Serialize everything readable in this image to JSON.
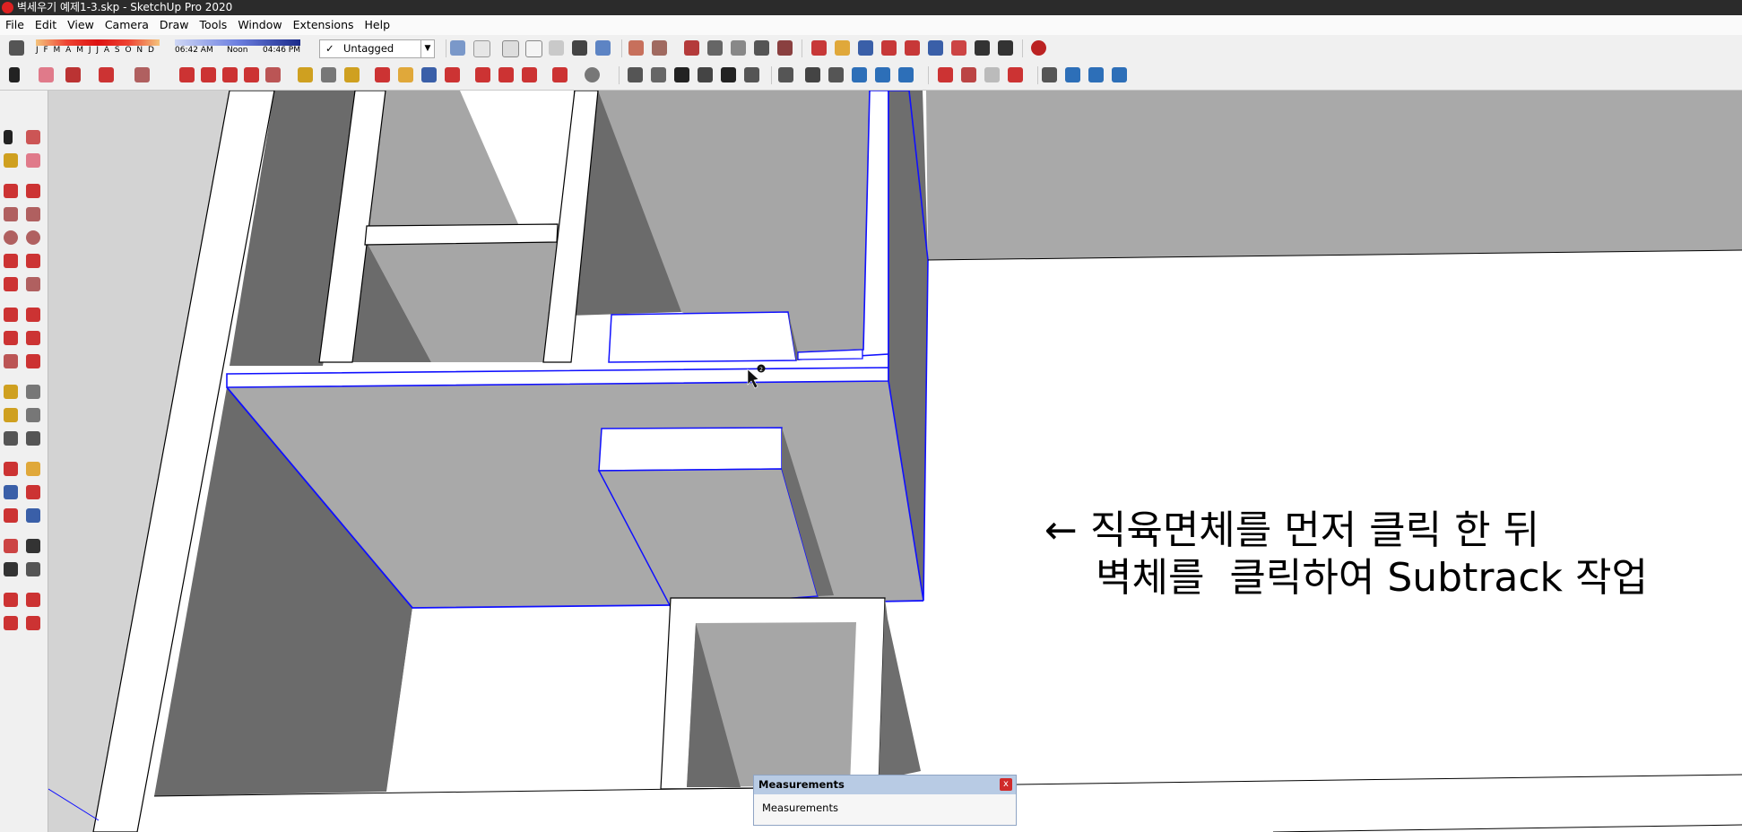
{
  "titlebar": {
    "title": "벽세우기 예제1-3.skp - SketchUp Pro 2020",
    "icon": "sketchup-logo-icon"
  },
  "menu": [
    "File",
    "Edit",
    "View",
    "Camera",
    "Draw",
    "Tools",
    "Window",
    "Extensions",
    "Help"
  ],
  "shadows": {
    "months": "J F M A M J J A S O N D",
    "time_am": "06:42 AM",
    "time_noon": "Noon",
    "time_pm": "04:46 PM"
  },
  "tags": {
    "selected": "Untagged",
    "check": "✓"
  },
  "annotation": {
    "line1": "← 직육면체를 먼저 클릭 한 뒤",
    "line2": "벽체를  클릭하여 Subtrack 작업"
  },
  "cursor_badge": "2",
  "measurements": {
    "title": "Measurements",
    "label": "Measurements",
    "close": "x"
  },
  "colors": {
    "selection": "#1010ff",
    "wall_top": "#ffffff",
    "face_light": "#a9a9a9",
    "face_dark": "#6a6a6a",
    "ground": "#d4d4d4"
  }
}
